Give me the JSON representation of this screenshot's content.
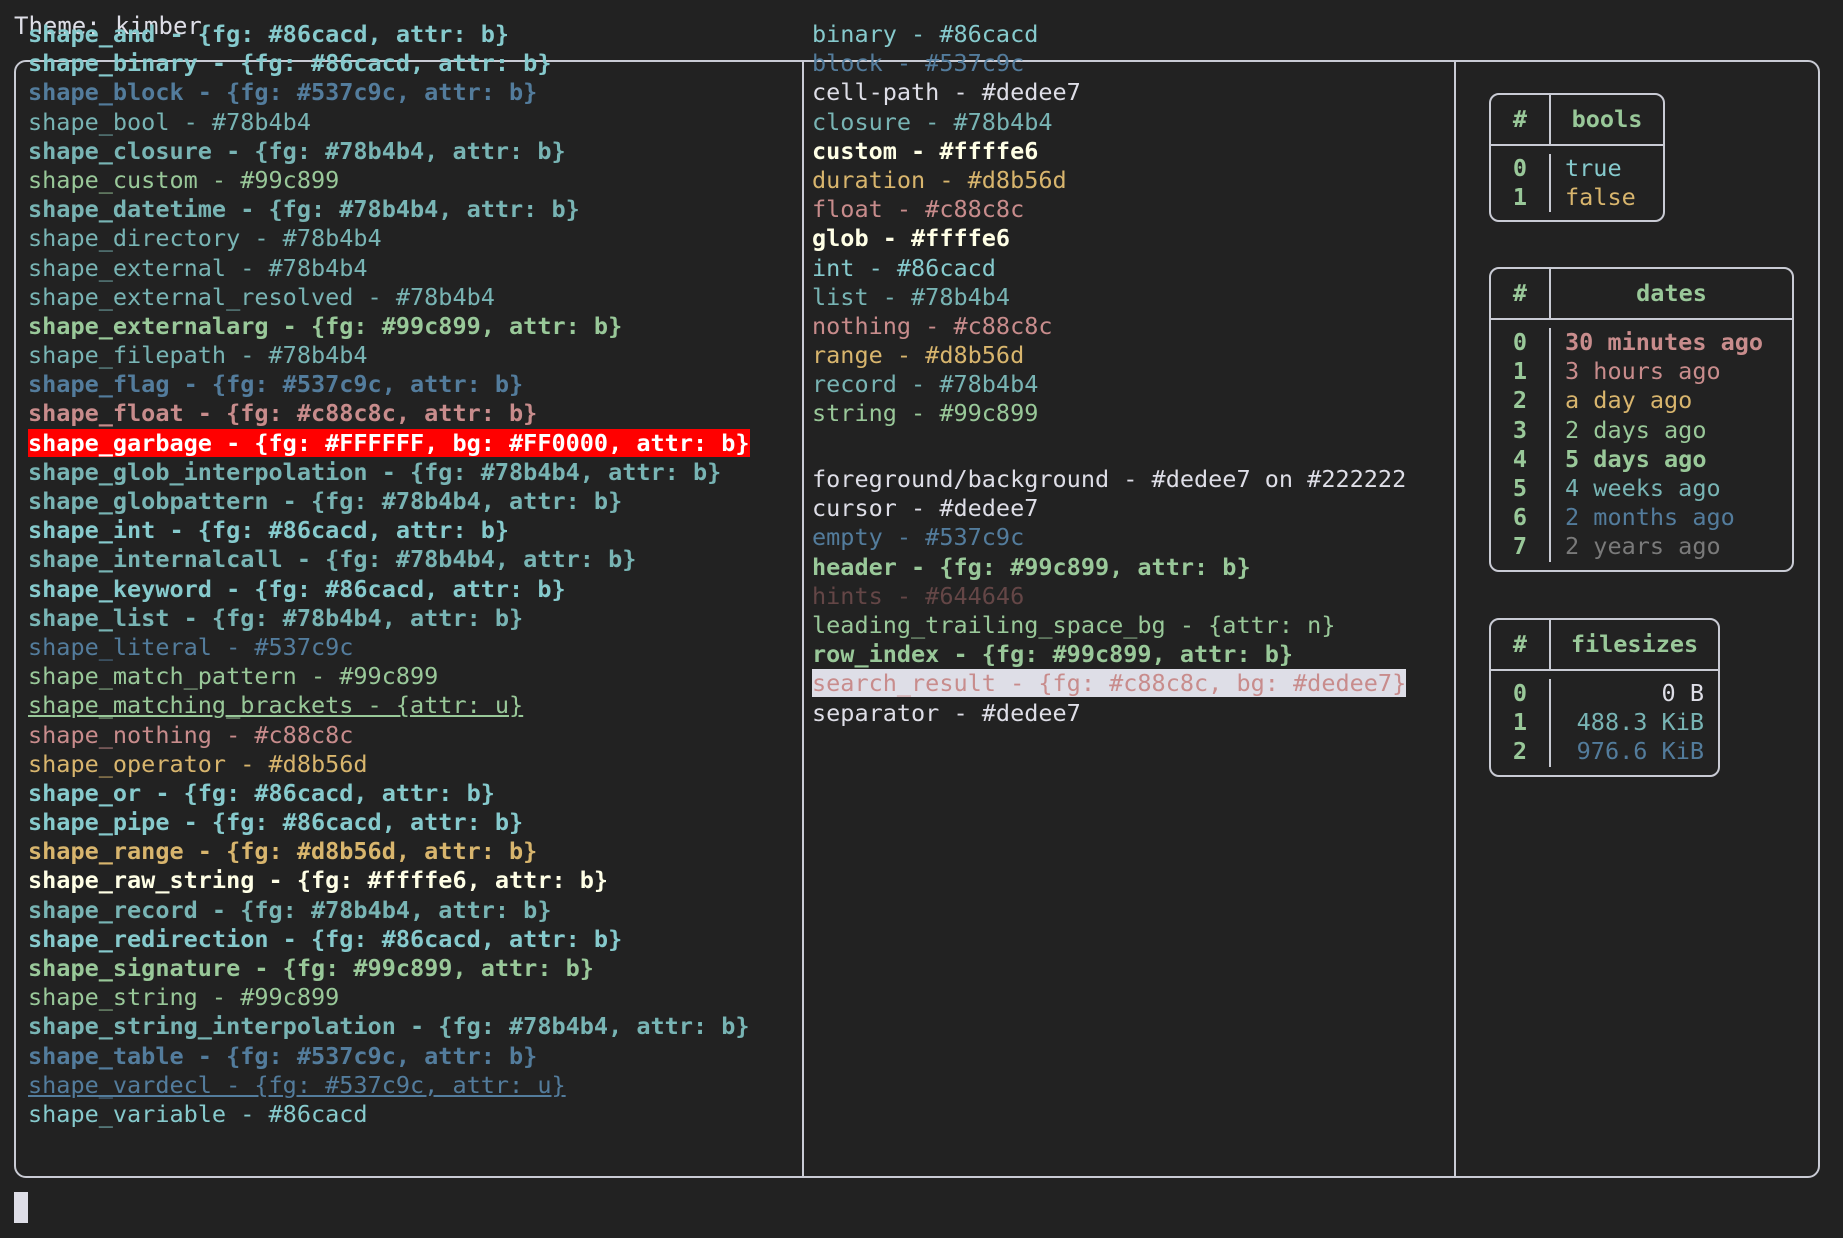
{
  "header": {
    "title": "Theme: kimber"
  },
  "palette": {
    "background": "#222222",
    "foreground": "#dedee7",
    "border": "#c9cbd4",
    "cyan": "#86cacd",
    "blue": "#537c9c",
    "teal": "#78b4b4",
    "green": "#99c899",
    "pink": "#c88c8c",
    "yellow": "#d8b56d",
    "white": "#ffffe6",
    "gray": "#644646",
    "garbage_fg": "#FFFFFF",
    "garbage_bg": "#FF0000",
    "search_result_fg": "#c88c8c",
    "search_result_bg": "#dedee7"
  },
  "shapes": [
    {
      "text": "shape_and - {fg: #86cacd, attr: b}",
      "fg": "#86cacd",
      "bold": true
    },
    {
      "text": "shape_binary - {fg: #86cacd, attr: b}",
      "fg": "#86cacd",
      "bold": true
    },
    {
      "text": "shape_block - {fg: #537c9c, attr: b}",
      "fg": "#537c9c",
      "bold": true
    },
    {
      "text": "shape_bool - #78b4b4",
      "fg": "#78b4b4",
      "bold": false
    },
    {
      "text": "shape_closure - {fg: #78b4b4, attr: b}",
      "fg": "#78b4b4",
      "bold": true
    },
    {
      "text": "shape_custom - #99c899",
      "fg": "#99c899",
      "bold": false
    },
    {
      "text": "shape_datetime - {fg: #78b4b4, attr: b}",
      "fg": "#78b4b4",
      "bold": true
    },
    {
      "text": "shape_directory - #78b4b4",
      "fg": "#78b4b4",
      "bold": false
    },
    {
      "text": "shape_external - #78b4b4",
      "fg": "#78b4b4",
      "bold": false
    },
    {
      "text": "shape_external_resolved - #78b4b4",
      "fg": "#78b4b4",
      "bold": false
    },
    {
      "text": "shape_externalarg - {fg: #99c899, attr: b}",
      "fg": "#99c899",
      "bold": true
    },
    {
      "text": "shape_filepath - #78b4b4",
      "fg": "#78b4b4",
      "bold": false
    },
    {
      "text": "shape_flag - {fg: #537c9c, attr: b}",
      "fg": "#537c9c",
      "bold": true
    },
    {
      "text": "shape_float - {fg: #c88c8c, attr: b}",
      "fg": "#c88c8c",
      "bold": true
    },
    {
      "text": "shape_garbage - {fg: #FFFFFF, bg: #FF0000, attr: b}",
      "fg": "#FFFFFF",
      "bg": "#FF0000",
      "bold": true
    },
    {
      "text": "shape_glob_interpolation - {fg: #78b4b4, attr: b}",
      "fg": "#78b4b4",
      "bold": true
    },
    {
      "text": "shape_globpattern - {fg: #78b4b4, attr: b}",
      "fg": "#78b4b4",
      "bold": true
    },
    {
      "text": "shape_int - {fg: #86cacd, attr: b}",
      "fg": "#86cacd",
      "bold": true
    },
    {
      "text": "shape_internalcall - {fg: #78b4b4, attr: b}",
      "fg": "#78b4b4",
      "bold": true
    },
    {
      "text": "shape_keyword - {fg: #86cacd, attr: b}",
      "fg": "#86cacd",
      "bold": true
    },
    {
      "text": "shape_list - {fg: #78b4b4, attr: b}",
      "fg": "#78b4b4",
      "bold": true
    },
    {
      "text": "shape_literal - #537c9c",
      "fg": "#537c9c",
      "bold": false
    },
    {
      "text": "shape_match_pattern - #99c899",
      "fg": "#99c899",
      "bold": false
    },
    {
      "text": "shape_matching_brackets - {attr: u}",
      "fg": "#99c899",
      "bold": false,
      "underline": true
    },
    {
      "text": "shape_nothing - #c88c8c",
      "fg": "#c88c8c",
      "bold": false
    },
    {
      "text": "shape_operator - #d8b56d",
      "fg": "#d8b56d",
      "bold": false
    },
    {
      "text": "shape_or - {fg: #86cacd, attr: b}",
      "fg": "#86cacd",
      "bold": true
    },
    {
      "text": "shape_pipe - {fg: #86cacd, attr: b}",
      "fg": "#86cacd",
      "bold": true
    },
    {
      "text": "shape_range - {fg: #d8b56d, attr: b}",
      "fg": "#d8b56d",
      "bold": true
    },
    {
      "text": "shape_raw_string - {fg: #ffffe6, attr: b}",
      "fg": "#ffffe6",
      "bold": true
    },
    {
      "text": "shape_record - {fg: #78b4b4, attr: b}",
      "fg": "#78b4b4",
      "bold": true
    },
    {
      "text": "shape_redirection - {fg: #86cacd, attr: b}",
      "fg": "#86cacd",
      "bold": true
    },
    {
      "text": "shape_signature - {fg: #99c899, attr: b}",
      "fg": "#99c899",
      "bold": true
    },
    {
      "text": "shape_string - #99c899",
      "fg": "#99c899",
      "bold": false
    },
    {
      "text": "shape_string_interpolation - {fg: #78b4b4, attr: b}",
      "fg": "#78b4b4",
      "bold": true
    },
    {
      "text": "shape_table - {fg: #537c9c, attr: b}",
      "fg": "#537c9c",
      "bold": true
    },
    {
      "text": "shape_vardecl - {fg: #537c9c, attr: u}",
      "fg": "#537c9c",
      "bold": false,
      "underline": true
    },
    {
      "text": "shape_variable - #86cacd",
      "fg": "#86cacd",
      "bold": false
    }
  ],
  "types": [
    {
      "text": "binary - #86cacd",
      "fg": "#86cacd",
      "bold": false
    },
    {
      "text": "block - #537c9c",
      "fg": "#537c9c",
      "bold": false
    },
    {
      "text": "cell-path - #dedee7",
      "fg": "#dedee7",
      "bold": false
    },
    {
      "text": "closure - #78b4b4",
      "fg": "#78b4b4",
      "bold": false
    },
    {
      "text": "custom - #ffffe6",
      "fg": "#ffffe6",
      "bold": true
    },
    {
      "text": "duration - #d8b56d",
      "fg": "#d8b56d",
      "bold": false
    },
    {
      "text": "float - #c88c8c",
      "fg": "#c88c8c",
      "bold": false
    },
    {
      "text": "glob - #ffffe6",
      "fg": "#ffffe6",
      "bold": true
    },
    {
      "text": "int - #86cacd",
      "fg": "#86cacd",
      "bold": false
    },
    {
      "text": "list - #78b4b4",
      "fg": "#78b4b4",
      "bold": false
    },
    {
      "text": "nothing - #c88c8c",
      "fg": "#c88c8c",
      "bold": false
    },
    {
      "text": "range - #d8b56d",
      "fg": "#d8b56d",
      "bold": false
    },
    {
      "text": "record - #78b4b4",
      "fg": "#78b4b4",
      "bold": false
    },
    {
      "text": "string - #99c899",
      "fg": "#99c899",
      "bold": false
    }
  ],
  "ui_elements": [
    {
      "text": "foreground/background - #dedee7 on #222222",
      "fg": "#dedee7",
      "bold": false
    },
    {
      "text": "cursor - #dedee7",
      "fg": "#dedee7",
      "bold": false
    },
    {
      "text": "empty - #537c9c",
      "fg": "#537c9c",
      "bold": false
    },
    {
      "text": "header - {fg: #99c899, attr: b}",
      "fg": "#99c899",
      "bold": true
    },
    {
      "text": "hints - #644646",
      "fg": "#644646",
      "bold": false
    },
    {
      "text": "leading_trailing_space_bg - {attr: n}",
      "fg": "#99c899",
      "bold": false
    },
    {
      "text": "row_index - {fg: #99c899, attr: b}",
      "fg": "#99c899",
      "bold": true
    },
    {
      "text": "search_result - {fg: #c88c8c, bg: #dedee7}",
      "fg": "#c88c8c",
      "bg": "#dedee7",
      "bold": false
    },
    {
      "text": "separator - #dedee7",
      "fg": "#dedee7",
      "bold": false
    }
  ],
  "tables": [
    {
      "name": "bools",
      "index_header": "#",
      "value_header": "bools",
      "rows": [
        {
          "index": "0",
          "value": "true",
          "fg": "#86cacd",
          "bold": false
        },
        {
          "index": "1",
          "value": "false",
          "fg": "#d8b56d",
          "bold": false
        }
      ]
    },
    {
      "name": "dates",
      "index_header": "#",
      "value_header": "dates",
      "rows": [
        {
          "index": "0",
          "value": "30 minutes ago",
          "fg": "#c88c8c",
          "bold": true
        },
        {
          "index": "1",
          "value": "3 hours ago",
          "fg": "#c88c8c",
          "bold": false
        },
        {
          "index": "2",
          "value": "a day ago",
          "fg": "#d8b56d",
          "bold": false
        },
        {
          "index": "3",
          "value": "2 days ago",
          "fg": "#99c899",
          "bold": false
        },
        {
          "index": "4",
          "value": "5 days ago",
          "fg": "#99c899",
          "bold": true
        },
        {
          "index": "5",
          "value": "4 weeks ago",
          "fg": "#78b4b4",
          "bold": false
        },
        {
          "index": "6",
          "value": "2 months ago",
          "fg": "#537c9c",
          "bold": false
        },
        {
          "index": "7",
          "value": "2 years ago",
          "fg": "#7a7a7a",
          "bold": false
        }
      ]
    },
    {
      "name": "filesizes",
      "index_header": "#",
      "value_header": "filesizes",
      "rows": [
        {
          "index": "0",
          "value": "0 B",
          "fg": "#dedee7",
          "bold": false
        },
        {
          "index": "1",
          "value": "488.3 KiB",
          "fg": "#78b4b4",
          "bold": false
        },
        {
          "index": "2",
          "value": "976.6 KiB",
          "fg": "#537c9c",
          "bold": false
        }
      ]
    }
  ]
}
